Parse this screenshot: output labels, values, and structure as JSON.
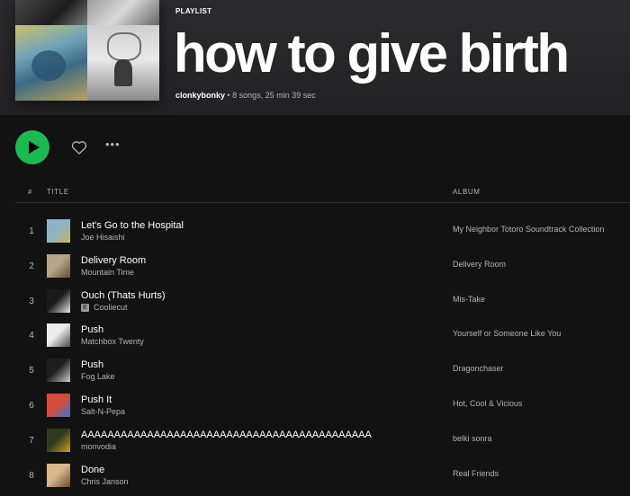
{
  "playlist": {
    "type_label": "PLAYLIST",
    "title": "how to give birth",
    "owner": "clonkybonky",
    "summary": " • 8 songs, 25 min 39 sec"
  },
  "actions": {
    "play_icon": "play-icon",
    "heart_icon": "heart-icon",
    "more_label": "•••"
  },
  "columns": {
    "index": "#",
    "title": "TITLE",
    "album": "ALBUM"
  },
  "colors": {
    "accent": "#1db954",
    "background": "#121212",
    "muted_text": "#b3b3b3"
  },
  "tracks": [
    {
      "index": "1",
      "title": "Let's Go to the Hospital",
      "artist": "Joe Hisaishi",
      "explicit": false,
      "album": "My Neighbor Totoro Soundtrack Collection",
      "thumb_colors": [
        "#8cb3c8",
        "#c7b56a"
      ]
    },
    {
      "index": "2",
      "title": "Delivery Room",
      "artist": "Mountain Time",
      "explicit": false,
      "album": "Delivery Room",
      "thumb_colors": [
        "#b8a58a",
        "#5e4f3d"
      ]
    },
    {
      "index": "3",
      "title": "Ouch (Thats Hurts)",
      "artist": "Cooliecut",
      "explicit": true,
      "explicit_label": "E",
      "album": "Mis-Take",
      "thumb_colors": [
        "#1a1a1a",
        "#e6e6e6"
      ]
    },
    {
      "index": "4",
      "title": "Push",
      "artist": "Matchbox Twenty",
      "explicit": false,
      "album": "Yourself or Someone Like You",
      "thumb_colors": [
        "#ececec",
        "#4a4a4a"
      ]
    },
    {
      "index": "5",
      "title": "Push",
      "artist": "Fog Lake",
      "explicit": false,
      "album": "Dragonchaser",
      "thumb_colors": [
        "#1e1e1e",
        "#cfcfcf"
      ]
    },
    {
      "index": "6",
      "title": "Push It",
      "artist": "Salt-N-Pepa",
      "explicit": false,
      "album": "Hot, Cool & Vicious",
      "thumb_colors": [
        "#d94a3a",
        "#3a78c4"
      ]
    },
    {
      "index": "7",
      "title": "AAAAAAAAAAAAAAAAAAAAAAAAAAAAAAAAAAAAAAAAAAAA",
      "artist": "monvodia",
      "explicit": false,
      "album": "belki sonra",
      "thumb_colors": [
        "#2f3a1e",
        "#c9a227"
      ]
    },
    {
      "index": "8",
      "title": "Done",
      "artist": "Chris Janson",
      "explicit": false,
      "album": "Real Friends",
      "thumb_colors": [
        "#d9b98c",
        "#6b4a2e"
      ]
    }
  ]
}
